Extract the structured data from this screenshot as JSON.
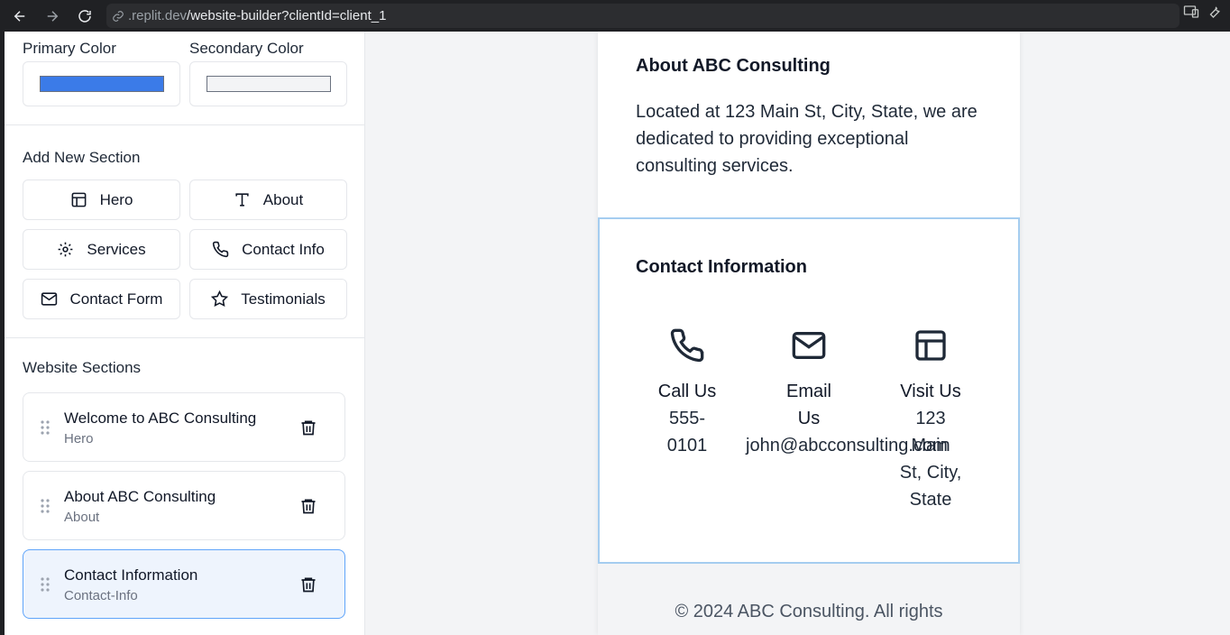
{
  "browser": {
    "url_prefix": ".replit.dev",
    "url_path": "/website-builder?clientId=client_1"
  },
  "sidebar": {
    "primary_color_label": "Primary Color",
    "secondary_color_label": "Secondary Color",
    "primary_color": "#3b7be8",
    "secondary_color": "#f3f4f6",
    "add_section_heading": "Add New Section",
    "add_buttons": [
      {
        "label": "Hero",
        "icon": "layout-icon"
      },
      {
        "label": "About",
        "icon": "type-icon"
      },
      {
        "label": "Services",
        "icon": "gear-icon"
      },
      {
        "label": "Contact Info",
        "icon": "phone-icon"
      },
      {
        "label": "Contact Form",
        "icon": "mail-icon"
      },
      {
        "label": "Testimonials",
        "icon": "star-icon"
      }
    ],
    "sections_heading": "Website Sections",
    "sections": [
      {
        "title": "Welcome to ABC Consulting",
        "type": "Hero"
      },
      {
        "title": "About ABC Consulting",
        "type": "About"
      },
      {
        "title": "Contact Information",
        "type": "Contact-Info"
      }
    ]
  },
  "preview": {
    "about_title": "About ABC Consulting",
    "about_text": "Located at 123 Main St, City, State, we are dedicated to providing exceptional consulting services.",
    "contact_title": "Contact Information",
    "contact_items": [
      {
        "label": "Call Us",
        "value": "555-\n0101",
        "icon": "phone-icon"
      },
      {
        "label": "Email\nUs",
        "value": "john@abcconsulting.com",
        "icon": "mail-icon"
      },
      {
        "label": "Visit Us",
        "value": "123\nMain\nSt, City,\nState",
        "icon": "layout-icon"
      }
    ],
    "footer_text": "© 2024 ABC Consulting. All rights"
  }
}
